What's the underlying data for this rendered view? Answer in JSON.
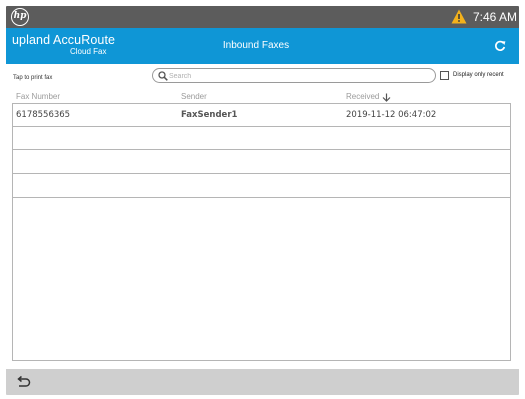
{
  "status_bar": {
    "logo_text": "hp",
    "time": "7:46 AM",
    "icons": [
      "hp-logo",
      "warning-icon"
    ]
  },
  "header": {
    "brand_line1": "upland AccuRoute",
    "brand_line2": "Cloud Fax",
    "title": "Inbound Faxes",
    "refresh_icon": "refresh-icon",
    "color": "#0f96d6"
  },
  "toolbar": {
    "hint": "Tap to print fax",
    "search_placeholder": "Search",
    "search_value": "",
    "display_recent_label": "Display only recent",
    "display_recent_checked": false
  },
  "table": {
    "columns": [
      "Fax Number",
      "Sender",
      "Received"
    ],
    "sort_icon": "arrow-down-icon",
    "rows": [
      {
        "fax_number": "6178556365",
        "sender": "FaxSender1",
        "received": "2019-11-12 06:47:02"
      },
      {
        "fax_number": "",
        "sender": "",
        "received": ""
      },
      {
        "fax_number": "",
        "sender": "",
        "received": ""
      },
      {
        "fax_number": "",
        "sender": "",
        "received": ""
      }
    ]
  },
  "bottom_bar": {
    "back_icon": "back-arrow-icon"
  }
}
